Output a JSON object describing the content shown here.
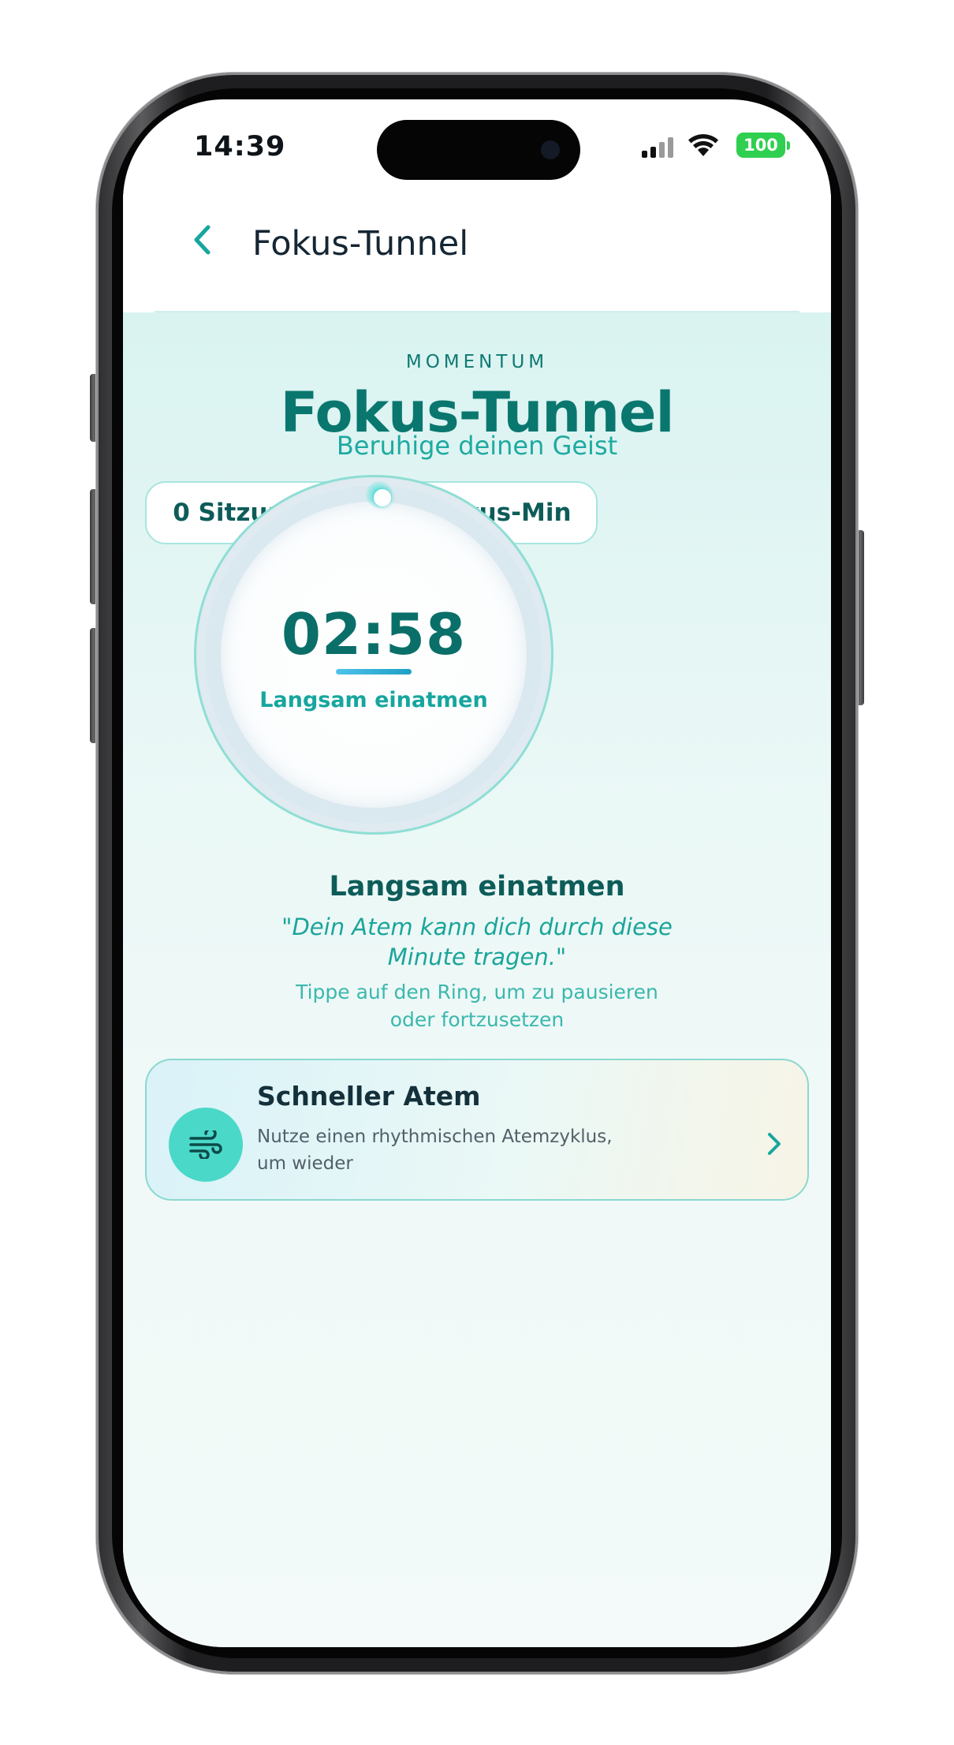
{
  "status_bar": {
    "time": "14:39",
    "battery": "100"
  },
  "header": {
    "back_icon": "chevron-left-icon",
    "title": "Fokus-Tunnel"
  },
  "hero": {
    "overline": "MOMENTUM",
    "title": "Fokus-Tunnel",
    "subtitle": "Beruhige deinen Geist"
  },
  "stats": [
    {
      "label": "0 Sitzungen"
    },
    {
      "label": "0 Fokus-Min"
    }
  ],
  "timer": {
    "value": "02:58",
    "phase": "Langsam einatmen"
  },
  "guidance": {
    "heading": "Langsam einatmen",
    "quote": "\"Dein Atem kann dich durch diese Minute tragen.\"",
    "hint": "Tippe auf den Ring, um zu pausieren oder fortzusetzen"
  },
  "card": {
    "icon": "wind-icon",
    "title": "Schneller Atem",
    "description": "Nutze einen rhythmischen Atemzyklus, um wieder"
  },
  "colors": {
    "accent": "#0a776f",
    "accent_light": "#1eaaa0",
    "ring": "#8fded4",
    "card_icon_bg": "#4ad8c9"
  }
}
